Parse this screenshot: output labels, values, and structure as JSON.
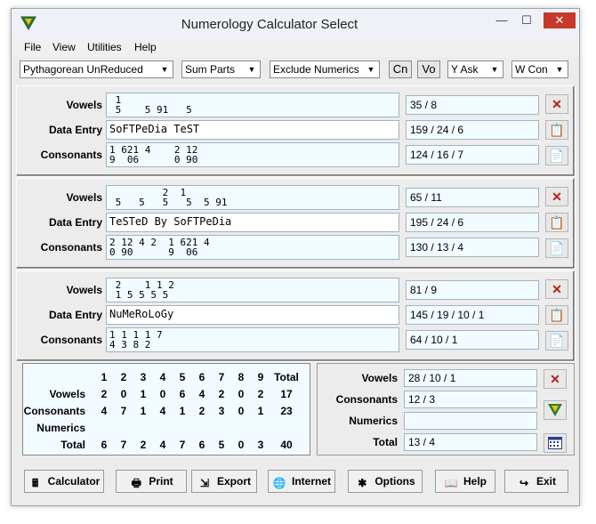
{
  "window": {
    "title": "Numerology Calculator Select"
  },
  "menu": [
    "File",
    "View",
    "Utilities",
    "Help"
  ],
  "toolbar": {
    "system": "Pythagorean UnReduced",
    "sum_mode": "Sum Parts",
    "numerics": "Exclude Numerics",
    "btn_cn": "Cn",
    "btn_vo": "Vo",
    "y_mode": "Y Ask",
    "w_mode": "W Con"
  },
  "labels": {
    "vowels": "Vowels",
    "data_entry": "Data Entry",
    "consonants": "Consonants"
  },
  "panels": [
    {
      "vowels_line1": " 1",
      "vowels_line2": " 5    5 91   5",
      "entry": "SoFTPeDia TeST",
      "cons_line1": "1 621 4    2 12",
      "cons_line2": "9  06      0 90",
      "vowels_result": "35 / 8",
      "entry_result": "159 / 24 / 6",
      "cons_result": "124 / 16 / 7"
    },
    {
      "vowels_line1": "         2  1",
      "vowels_line2": " 5   5   5   5  5 91",
      "entry": "TeSTeD By SoFTPeDia",
      "cons_line1": "2 12 4 2  1 621 4",
      "cons_line2": "0 90      9  06",
      "vowels_result": "65 / 11",
      "entry_result": "195 / 24 / 6",
      "cons_result": "130 / 13 / 4"
    },
    {
      "vowels_line1": " 2    1 1 2",
      "vowels_line2": " 1 5 5 5 5",
      "entry": "NuMeRoLoGy",
      "cons_line1": "1 1 1 1 7",
      "cons_line2": "4 3 8 2",
      "vowels_result": "81 / 9",
      "entry_result": "145 / 19 / 10 / 1",
      "cons_result": "64 / 10 / 1"
    }
  ],
  "grid": {
    "headers": [
      "1",
      "2",
      "3",
      "4",
      "5",
      "6",
      "7",
      "8",
      "9",
      "Total"
    ],
    "rows": [
      {
        "label": "Vowels",
        "values": [
          "2",
          "0",
          "1",
          "0",
          "6",
          "4",
          "2",
          "0",
          "2",
          "17"
        ]
      },
      {
        "label": "Consonants",
        "values": [
          "4",
          "7",
          "1",
          "4",
          "1",
          "2",
          "3",
          "0",
          "1",
          "23"
        ]
      },
      {
        "label": "Numerics",
        "values": [
          "",
          "",
          "",
          "",
          "",
          "",
          "",
          "",
          "",
          ""
        ]
      },
      {
        "label": "Total",
        "values": [
          "6",
          "7",
          "2",
          "4",
          "7",
          "6",
          "5",
          "0",
          "3",
          "40"
        ]
      }
    ]
  },
  "summary": {
    "vowels_label": "Vowels",
    "vowels": "28 / 10 / 1",
    "consonants_label": "Consonants",
    "consonants": "12 / 3",
    "numerics_label": "Numerics",
    "numerics": "",
    "total_label": "Total",
    "total": "13 / 4"
  },
  "buttons": {
    "calculator": "Calculator",
    "print": "Print",
    "export": "Export",
    "internet": "Internet",
    "options": "Options",
    "help": "Help",
    "exit": "Exit"
  },
  "colors": {
    "field_bg": "#f2fbff",
    "close_red": "#c7392b",
    "delete_x": "#b81c1c"
  }
}
